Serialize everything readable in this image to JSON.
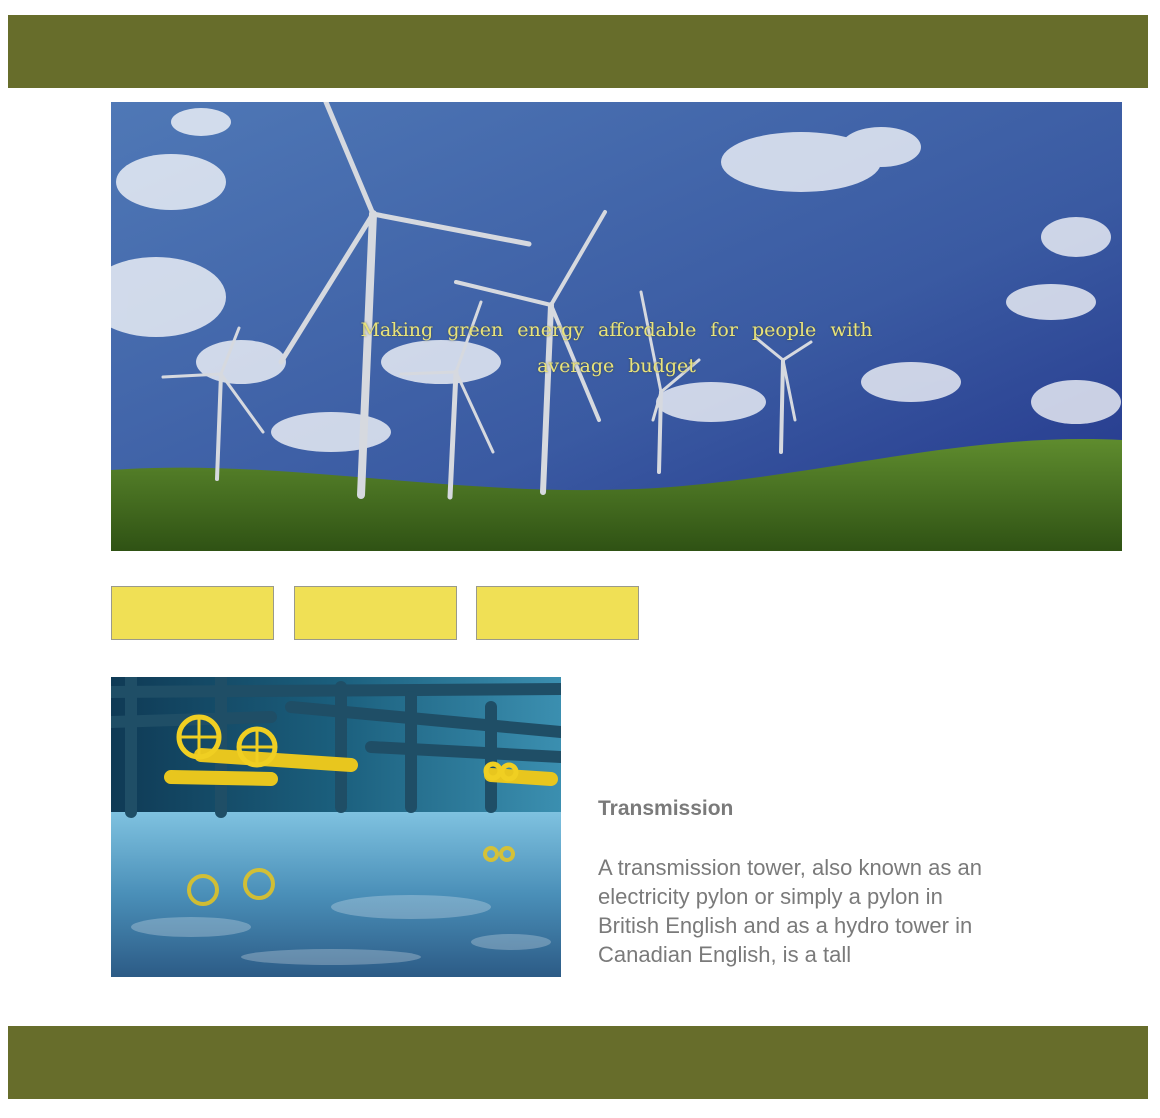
{
  "hero": {
    "tagline": "Making green energy affordable for people with average budget"
  },
  "article": {
    "title": "Transmission",
    "body": "A transmission tower, also known as an electricity pylon or simply a pylon in British English and as a hydro tower in Canadian English, is a tall"
  },
  "colors": {
    "header_bar": "#676d2b",
    "footer_bar": "#676d2b",
    "tile_fill": "#f0e055",
    "tagline": "#e9e37a",
    "article_text": "#7a7a7a"
  },
  "images": {
    "hero": "wind-turbines-landscape-photo",
    "article": "industrial-pipes-valves-photo"
  }
}
